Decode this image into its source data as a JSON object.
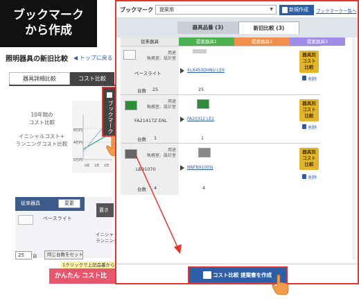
{
  "callout": {
    "line1": "ブックマーク",
    "line2": "から作成"
  },
  "background": {
    "title": "照明器具の新旧比較",
    "back_link": "◀ トップに戻る",
    "tabs": [
      "器具詳細比較",
      "コスト比較"
    ],
    "ten_year_line1": "10年間の",
    "ten_year_line2": "コスト比較",
    "initial_line1": "イニシャルコスト+",
    "initial_line2": "ランニングコスト比較",
    "chart_ticks_y": [
      "8万円",
      "4万円",
      "0万円"
    ],
    "chart_ticks_x": [
      "0年",
      "1年",
      "2年"
    ],
    "bookmark_tab_label": "ブックマーク",
    "panel_label": "従来器具",
    "change_button": "変更",
    "panel_item": "ベースライト",
    "side_button": "置き",
    "side_text_1": "イニシャ",
    "side_text_2": "ランニングコ",
    "qty_value": "25",
    "qty_unit": "台",
    "reset_button": "同じ台数をセット",
    "note": "1クリックで上記品番からす",
    "easy_button": "かんたん コスト比"
  },
  "panel": {
    "header_title": "ブックマーク",
    "select_value": "提案用",
    "new_button": "新規作成",
    "list_link": "ブックマーク一覧へ",
    "tabs": [
      "器具品番 (3)",
      "新旧比較 (3)"
    ],
    "columns": [
      "従来器具",
      "提案器具1",
      "提案器具2",
      "提案器具3"
    ],
    "qty_label": "台数",
    "cost_button": [
      "器具別",
      "コスト",
      "比較"
    ],
    "delete_label": "削除",
    "rows": [
      {
        "purpose_label": "用途",
        "purpose": "執務室、設計室",
        "old_model": "ベースライト",
        "new_model": "XLX450DHNU LE9",
        "old_qty": "25",
        "new_qty": "25"
      },
      {
        "purpose_label": "用途",
        "purpose": "執務室、設計室",
        "old_model": "FA21417Z ENL",
        "new_model": "FA20312 LE1",
        "old_qty": "1",
        "new_qty": "1"
      },
      {
        "purpose_label": "用途",
        "purpose": "執務室、設計室",
        "old_model": "LB91070",
        "new_model": "NNFB91005J",
        "old_qty": "4",
        "new_qty": "4"
      }
    ],
    "create_button": "コスト比較 提案書を作成"
  },
  "colors": {
    "accent_red": "#e8332b",
    "primary_blue": "#2c5fa6",
    "cost_gold": "#e3b52d",
    "col1_green": "#4caf50",
    "col2_orange": "#f0904a",
    "col3_purple": "#a08ce6"
  }
}
